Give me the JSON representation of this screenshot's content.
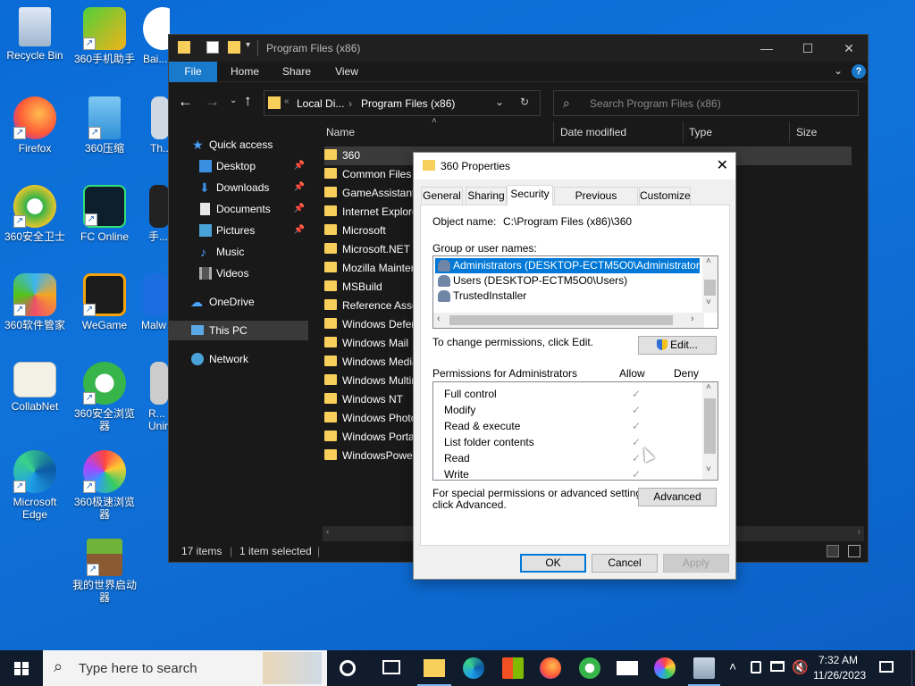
{
  "desktop": {
    "icons": [
      {
        "label": "Recycle Bin"
      },
      {
        "label": "360手机助手"
      },
      {
        "label": "Bai..."
      },
      {
        "label": "Firefox"
      },
      {
        "label": "360压缩"
      },
      {
        "label": "Th..."
      },
      {
        "label": "360安全卫士"
      },
      {
        "label": "FC Online"
      },
      {
        "label": "手..."
      },
      {
        "label": "360软件管家"
      },
      {
        "label": "WeGame"
      },
      {
        "label": "Malw"
      },
      {
        "label": "CollabNet"
      },
      {
        "label": "360安全浏览器"
      },
      {
        "label": "R... Unin..."
      },
      {
        "label": "Microsoft Edge"
      },
      {
        "label": "360极速浏览器"
      },
      {
        "label": "我的世界启动器"
      }
    ]
  },
  "explorer": {
    "title": "Program Files (x86)",
    "ribbon_tabs": [
      "File",
      "Home",
      "Share",
      "View"
    ],
    "breadcrumb": [
      "Local Di...",
      "Program Files (x86)"
    ],
    "search_placeholder": "Search Program Files (x86)",
    "nav": {
      "quick_access": "Quick access",
      "items": [
        {
          "label": "Desktop",
          "pinned": true
        },
        {
          "label": "Downloads",
          "pinned": true
        },
        {
          "label": "Documents",
          "pinned": true
        },
        {
          "label": "Pictures",
          "pinned": true
        },
        {
          "label": "Music",
          "pinned": false
        },
        {
          "label": "Videos",
          "pinned": false
        }
      ],
      "onedrive": "OneDrive",
      "this_pc": "This PC",
      "network": "Network"
    },
    "columns": [
      "Name",
      "Date modified",
      "Type",
      "Size"
    ],
    "files": [
      "360",
      "Common Files",
      "GameAssistant",
      "Internet Explorer",
      "Microsoft",
      "Microsoft.NET",
      "Mozilla Maintenance",
      "MSBuild",
      "Reference Assemblies",
      "Windows Defender",
      "Windows Mail",
      "Windows Media Player",
      "Windows Multimedia",
      "Windows NT",
      "Windows Photo Viewer",
      "Windows Portable Devices",
      "WindowsPowerShell"
    ],
    "selected_file": "360",
    "status": {
      "items": "17 items",
      "selected": "1 item selected"
    }
  },
  "dialog": {
    "title": "360 Properties",
    "tabs": [
      "General",
      "Sharing",
      "Security",
      "Previous Versions",
      "Customize"
    ],
    "active_tab": "Security",
    "object_name_label": "Object name:",
    "object_name_value": "C:\\Program Files (x86)\\360",
    "group_label": "Group or user names:",
    "users": [
      "Administrators (DESKTOP-ECTM5O0\\Administrators)",
      "Users (DESKTOP-ECTM5O0\\Users)",
      "TrustedInstaller"
    ],
    "selected_user": "Administrators (DESKTOP-ECTM5O0\\Administrators)",
    "change_text": "To change permissions, click Edit.",
    "edit_button": "Edit...",
    "permissions_label": "Permissions for Administrators",
    "allow_label": "Allow",
    "deny_label": "Deny",
    "permissions": [
      {
        "name": "Full control",
        "allow": true,
        "deny": false
      },
      {
        "name": "Modify",
        "allow": true,
        "deny": false
      },
      {
        "name": "Read & execute",
        "allow": true,
        "deny": false
      },
      {
        "name": "List folder contents",
        "allow": true,
        "deny": false
      },
      {
        "name": "Read",
        "allow": true,
        "deny": false
      },
      {
        "name": "Write",
        "allow": true,
        "deny": false
      }
    ],
    "advanced_text_1": "For special permissions or advanced settings,",
    "advanced_text_2": "click Advanced.",
    "advanced_button": "Advanced",
    "ok_button": "OK",
    "cancel_button": "Cancel",
    "apply_button": "Apply"
  },
  "taskbar": {
    "search_placeholder": "Type here to search",
    "time": "7:32 AM",
    "date": "11/26/2023"
  },
  "colors": {
    "accent": "#0078d7",
    "folder": "#f8cf5b",
    "desktop_bg": "#0f73db",
    "explorer_bg": "#191919"
  }
}
